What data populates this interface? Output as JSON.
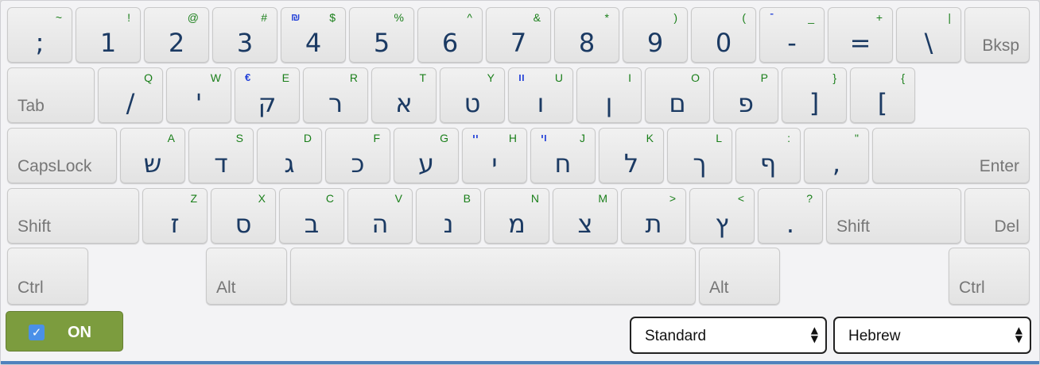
{
  "keyboard": {
    "rows": [
      [
        {
          "name": "key-backtick",
          "main": ";",
          "shift": "~"
        },
        {
          "name": "key-1",
          "main": "1",
          "shift": "!"
        },
        {
          "name": "key-2",
          "main": "2",
          "shift": "@"
        },
        {
          "name": "key-3",
          "main": "3",
          "shift": "#"
        },
        {
          "name": "key-4",
          "main": "4",
          "shift": "$",
          "alt": "₪"
        },
        {
          "name": "key-5",
          "main": "5",
          "shift": "%"
        },
        {
          "name": "key-6",
          "main": "6",
          "shift": "^"
        },
        {
          "name": "key-7",
          "main": "7",
          "shift": "&"
        },
        {
          "name": "key-8",
          "main": "8",
          "shift": "*"
        },
        {
          "name": "key-9",
          "main": "9",
          "shift": ")"
        },
        {
          "name": "key-0",
          "main": "0",
          "shift": "("
        },
        {
          "name": "key-minus",
          "main": "-",
          "shift": "_",
          "alt": "־"
        },
        {
          "name": "key-equals",
          "main": "=",
          "shift": "+"
        },
        {
          "name": "key-backslash",
          "main": "\\",
          "shift": "|"
        },
        {
          "name": "key-backspace",
          "fn": "Bksp",
          "fnAlign": "right"
        }
      ],
      [
        {
          "name": "key-tab",
          "fn": "Tab",
          "fnAlign": "left"
        },
        {
          "name": "key-q",
          "main": "/",
          "shift": "Q"
        },
        {
          "name": "key-w",
          "main": "'",
          "shift": "W"
        },
        {
          "name": "key-e",
          "main": "ק",
          "shift": "E",
          "alt": "€"
        },
        {
          "name": "key-r",
          "main": "ר",
          "shift": "R"
        },
        {
          "name": "key-t",
          "main": "א",
          "shift": "T"
        },
        {
          "name": "key-y",
          "main": "ט",
          "shift": "Y"
        },
        {
          "name": "key-u",
          "main": "ו",
          "shift": "U",
          "alt": "װ"
        },
        {
          "name": "key-i",
          "main": "ן",
          "shift": "I"
        },
        {
          "name": "key-o",
          "main": "ם",
          "shift": "O"
        },
        {
          "name": "key-p",
          "main": "פ",
          "shift": "P"
        },
        {
          "name": "key-bracket-right",
          "main": "]",
          "shift": "}"
        },
        {
          "name": "key-bracket-left",
          "main": "[",
          "shift": "{"
        }
      ],
      [
        {
          "name": "key-capslock",
          "fn": "CapsLock",
          "fnAlign": "left"
        },
        {
          "name": "key-a",
          "main": "ש",
          "shift": "A"
        },
        {
          "name": "key-s",
          "main": "ד",
          "shift": "S"
        },
        {
          "name": "key-d",
          "main": "ג",
          "shift": "D"
        },
        {
          "name": "key-f",
          "main": "כ",
          "shift": "F"
        },
        {
          "name": "key-g",
          "main": "ע",
          "shift": "G"
        },
        {
          "name": "key-h",
          "main": "י",
          "shift": "H",
          "alt": "ײ"
        },
        {
          "name": "key-j",
          "main": "ח",
          "shift": "J",
          "alt": "ױ"
        },
        {
          "name": "key-k",
          "main": "ל",
          "shift": "K"
        },
        {
          "name": "key-l",
          "main": "ך",
          "shift": "L"
        },
        {
          "name": "key-semicolon",
          "main": "ף",
          "shift": ":"
        },
        {
          "name": "key-quote",
          "main": ",",
          "shift": "\""
        },
        {
          "name": "key-enter",
          "fn": "Enter",
          "fnAlign": "right"
        }
      ],
      [
        {
          "name": "key-shift-left",
          "fn": "Shift",
          "fnAlign": "left"
        },
        {
          "name": "key-z",
          "main": "ז",
          "shift": "Z"
        },
        {
          "name": "key-x",
          "main": "ס",
          "shift": "X"
        },
        {
          "name": "key-c",
          "main": "ב",
          "shift": "C"
        },
        {
          "name": "key-v",
          "main": "ה",
          "shift": "V"
        },
        {
          "name": "key-b",
          "main": "נ",
          "shift": "B"
        },
        {
          "name": "key-n",
          "main": "מ",
          "shift": "N"
        },
        {
          "name": "key-m",
          "main": "צ",
          "shift": "M"
        },
        {
          "name": "key-comma",
          "main": "ת",
          "shift": ">"
        },
        {
          "name": "key-period",
          "main": "ץ",
          "shift": "<"
        },
        {
          "name": "key-slash",
          "main": ".",
          "shift": "?"
        },
        {
          "name": "key-shift-right",
          "fn": "Shift",
          "fnAlign": "left"
        },
        {
          "name": "key-delete",
          "fn": "Del",
          "fnAlign": "right"
        }
      ],
      [
        {
          "name": "key-ctrl-left",
          "fn": "Ctrl",
          "fnAlign": "left"
        },
        {
          "name": "key-alt-left",
          "fn": "Alt",
          "fnAlign": "left"
        },
        {
          "name": "key-space"
        },
        {
          "name": "key-alt-right",
          "fn": "Alt",
          "fnAlign": "left"
        },
        {
          "name": "key-ctrl-right",
          "fn": "Ctrl",
          "fnAlign": "left"
        }
      ]
    ]
  },
  "controls": {
    "toggle": {
      "label": "ON",
      "checked_icon": "checkmark-icon"
    },
    "layout_select": {
      "value": "Standard"
    },
    "language_select": {
      "value": "Hebrew"
    }
  }
}
